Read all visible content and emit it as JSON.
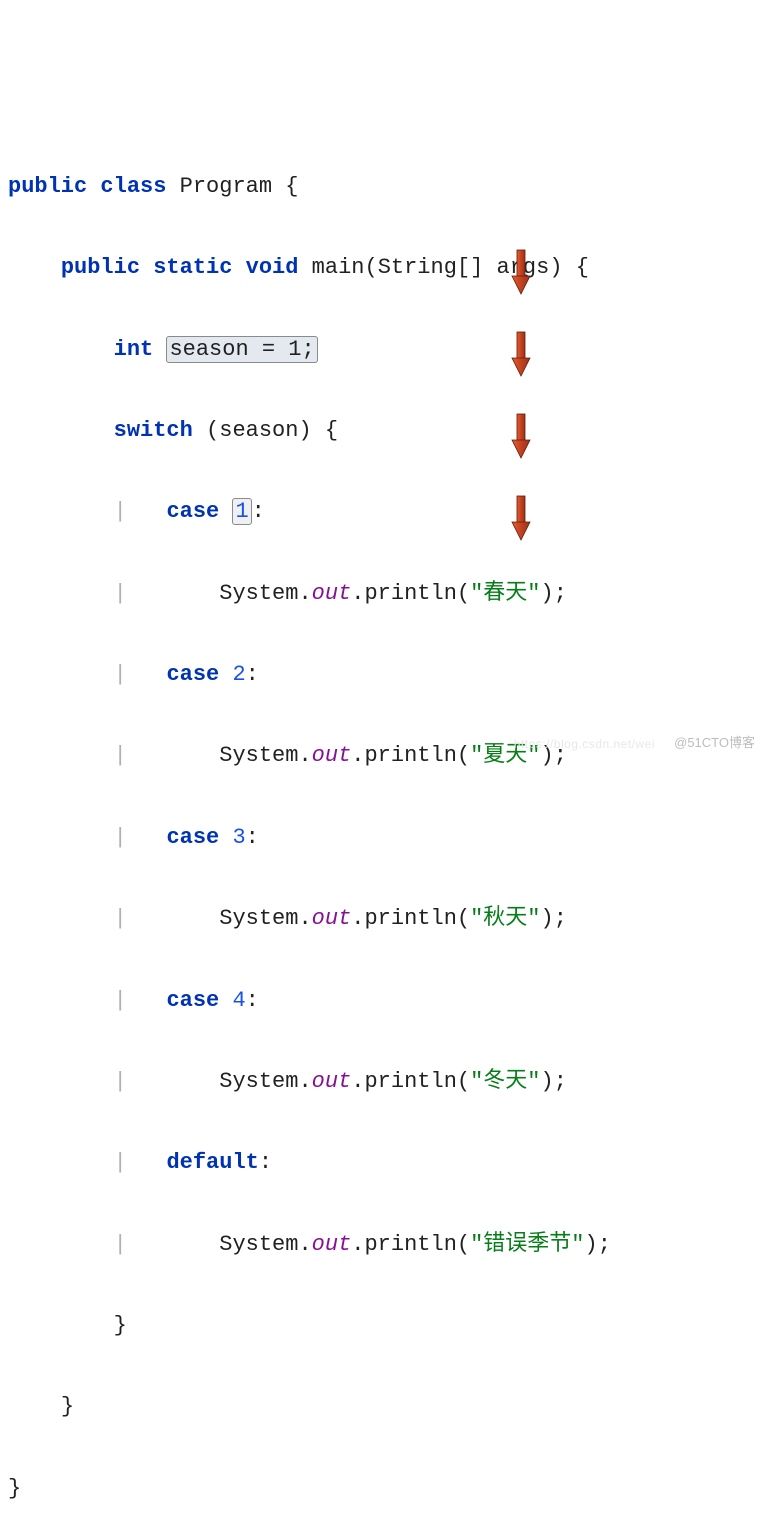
{
  "code": {
    "l1_kw1": "public",
    "l1_kw2": "class",
    "l1_name": "Program",
    "l1_brace": "{",
    "l2_kw1": "public",
    "l2_kw2": "static",
    "l2_kw3": "void",
    "l2_name": "main",
    "l2_paren1": "(",
    "l2_type": "String",
    "l2_brk": "[]",
    "l2_arg": "args",
    "l2_paren2": ")",
    "l2_brace": "{",
    "l3_kw": "int",
    "l3_expr": "season = 1;",
    "l4_kw": "switch",
    "l4_paren1": "(",
    "l4_var": "season",
    "l4_paren2": ")",
    "l4_brace": "{",
    "l5_kw": "case",
    "l5_val": "1",
    "l5_colon": ":",
    "l6_sys": "System",
    "l6_dot1": ".",
    "l6_out": "out",
    "l6_dot2": ".",
    "l6_m": "println",
    "l6_p1": "(",
    "l6_str": "\"春天\"",
    "l6_p2": ")",
    "l6_semi": ";",
    "l7_kw": "case",
    "l7_val": "2",
    "l7_colon": ":",
    "l8_sys": "System",
    "l8_dot1": ".",
    "l8_out": "out",
    "l8_dot2": ".",
    "l8_m": "println",
    "l8_p1": "(",
    "l8_str": "\"夏天\"",
    "l8_p2": ")",
    "l8_semi": ";",
    "l9_kw": "case",
    "l9_val": "3",
    "l9_colon": ":",
    "l10_sys": "System",
    "l10_dot1": ".",
    "l10_out": "out",
    "l10_dot2": ".",
    "l10_m": "println",
    "l10_p1": "(",
    "l10_str": "\"秋天\"",
    "l10_p2": ")",
    "l10_semi": ";",
    "l11_kw": "case",
    "l11_val": "4",
    "l11_colon": ":",
    "l12_sys": "System",
    "l12_dot1": ".",
    "l12_out": "out",
    "l12_dot2": ".",
    "l12_m": "println",
    "l12_p1": "(",
    "l12_str": "\"冬天\"",
    "l12_p2": ")",
    "l12_semi": ";",
    "l13_kw": "default",
    "l13_colon": ":",
    "l14_sys": "System",
    "l14_dot1": ".",
    "l14_out": "out",
    "l14_dot2": ".",
    "l14_m": "println",
    "l14_p1": "(",
    "l14_str": "\"错误季节\"",
    "l14_p2": ")",
    "l14_semi": ";",
    "l15_brace": "}",
    "l16_brace": "}",
    "l17_brace": "}"
  },
  "guide": "|",
  "watermark": "@51CTO博客",
  "watermark2": "https://blog.csdn.net/wei"
}
